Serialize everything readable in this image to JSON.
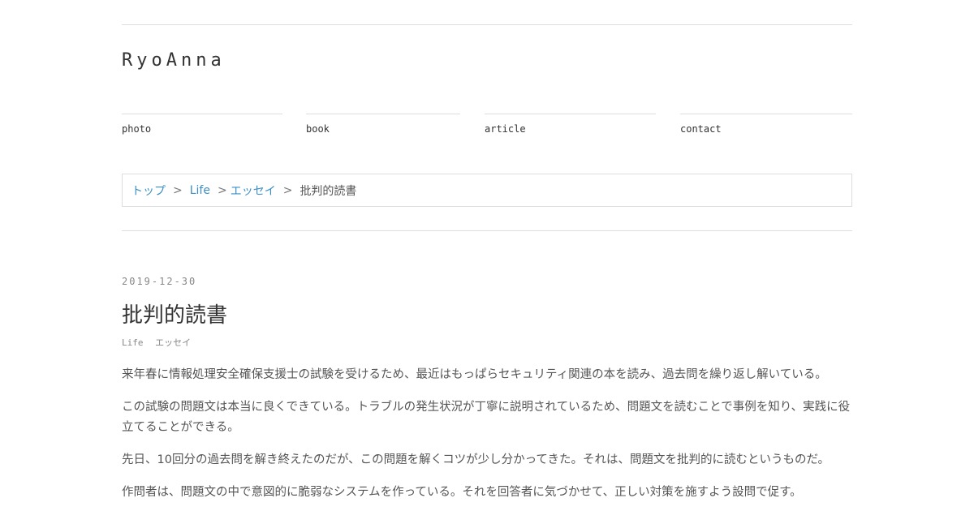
{
  "site": {
    "title": "RyoAnna"
  },
  "nav": {
    "photo": "photo",
    "book": "book",
    "article": "article",
    "contact": "contact"
  },
  "breadcrumb": {
    "top": "トップ",
    "life": "Life",
    "essay": "エッセイ",
    "current": "批判的読書",
    "separator": ">"
  },
  "post": {
    "date": "2019-12-30",
    "title": "批判的読書",
    "tags": [
      "Life",
      "エッセイ"
    ],
    "paragraphs": [
      "来年春に情報処理安全確保支援士の試験を受けるため、最近はもっぱらセキュリティ関連の本を読み、過去問を繰り返し解いている。",
      "この試験の問題文は本当に良くできている。トラブルの発生状況が丁寧に説明されているため、問題文を読むことで事例を知り、実践に役立てることができる。",
      "先日、10回分の過去問を解き終えたのだが、この問題を解くコツが少し分かってきた。それは、問題文を批判的に読むというものだ。",
      "作問者は、問題文の中で意図的に脆弱なシステムを作っている。それを回答者に気づかせて、正しい対策を施すよう設問で促す。"
    ]
  },
  "colors": {
    "link": "#3b8fc7",
    "rule": "#dddddd",
    "text": "#444444"
  }
}
